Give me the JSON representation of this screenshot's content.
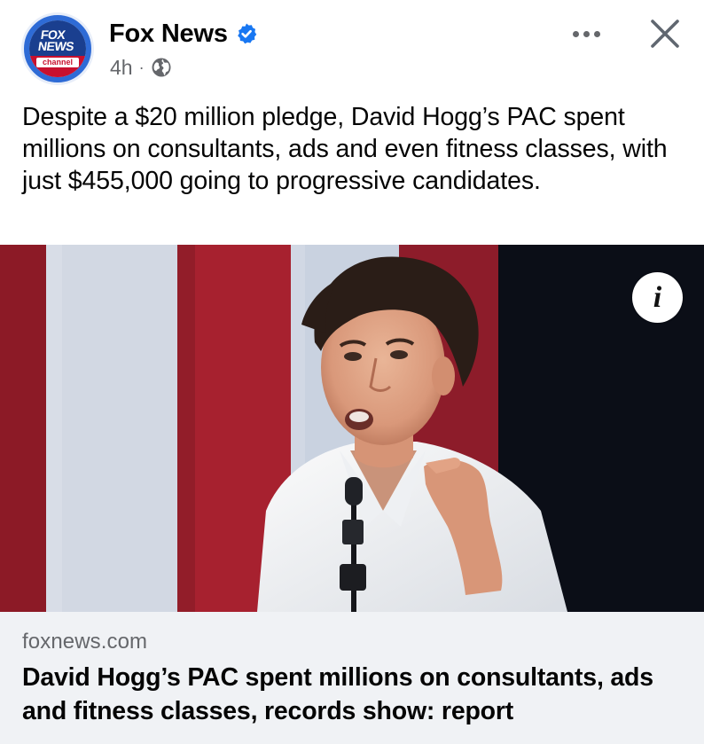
{
  "post": {
    "page_name": "Fox News",
    "timestamp": "4h",
    "separator": "·",
    "avatar": {
      "line1": "FOX",
      "line2": "NEWS",
      "line3": "channel"
    },
    "icons": {
      "verified": "verified-badge-icon",
      "audience": "globe-icon",
      "more": "more-options-icon",
      "close": "close-icon",
      "info": "info-icon"
    },
    "caption": "Despite a $20 million pledge, David Hogg’s PAC spent millions on consultants, ads and even fitness classes, with just $455,000 going to progressive candidates.",
    "image_info_label": "i",
    "link": {
      "domain": "foxnews.com",
      "title": "David Hogg’s PAC spent millions on consultants, ads and fitness classes, records show: report"
    }
  },
  "colors": {
    "verified_blue": "#1877f2",
    "secondary_text": "#65676b",
    "link_preview_bg": "#f0f2f5"
  }
}
